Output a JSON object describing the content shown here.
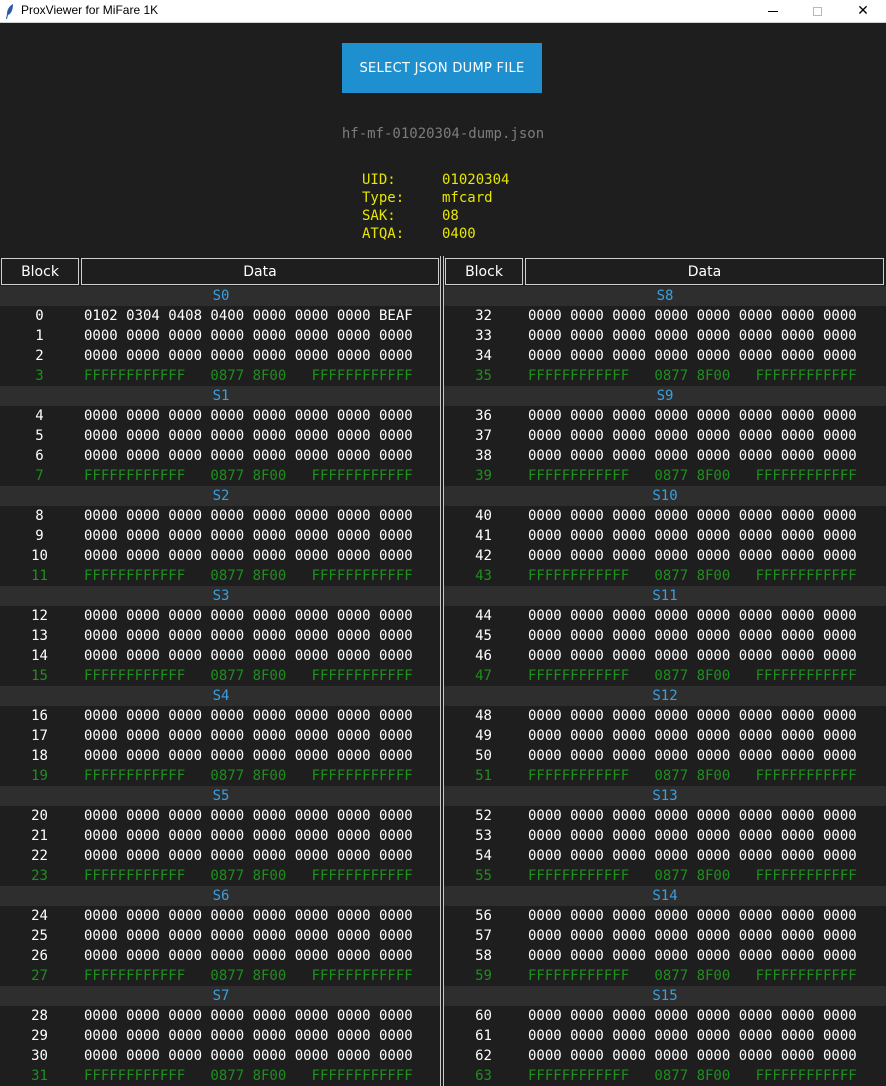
{
  "window": {
    "title": "ProxViewer for MiFare 1K",
    "minimize_glyph": "",
    "close_glyph": "✕"
  },
  "toolbar": {
    "select_button_label": "SELECT JSON DUMP FILE"
  },
  "file": {
    "name": "hf-mf-01020304-dump.json"
  },
  "card_info": [
    {
      "label": "UID:",
      "value": "01020304"
    },
    {
      "label": "Type:",
      "value": "mfcard"
    },
    {
      "label": "SAK:",
      "value": "08"
    },
    {
      "label": "ATQA:",
      "value": "0400"
    }
  ],
  "table_headers": {
    "block": "Block",
    "data": "Data"
  },
  "colors": {
    "accent": "#1e90cf",
    "sector_title": "#38a0e0",
    "info_text": "#e6e600",
    "trailer": "#1f8f1f",
    "background": "#1e1e1e"
  },
  "panels": [
    {
      "sectors": [
        {
          "title": "S0",
          "rows": [
            {
              "block": "0",
              "data": "0102 0304 0408 0400 0000 0000 0000 BEAF"
            },
            {
              "block": "1",
              "data": "0000 0000 0000 0000 0000 0000 0000 0000"
            },
            {
              "block": "2",
              "data": "0000 0000 0000 0000 0000 0000 0000 0000"
            },
            {
              "block": "3",
              "data": "FFFFFFFFFFFF   0877 8F00   FFFFFFFFFFFF",
              "trailer": true
            }
          ]
        },
        {
          "title": "S1",
          "rows": [
            {
              "block": "4",
              "data": "0000 0000 0000 0000 0000 0000 0000 0000"
            },
            {
              "block": "5",
              "data": "0000 0000 0000 0000 0000 0000 0000 0000"
            },
            {
              "block": "6",
              "data": "0000 0000 0000 0000 0000 0000 0000 0000"
            },
            {
              "block": "7",
              "data": "FFFFFFFFFFFF   0877 8F00   FFFFFFFFFFFF",
              "trailer": true
            }
          ]
        },
        {
          "title": "S2",
          "rows": [
            {
              "block": "8",
              "data": "0000 0000 0000 0000 0000 0000 0000 0000"
            },
            {
              "block": "9",
              "data": "0000 0000 0000 0000 0000 0000 0000 0000"
            },
            {
              "block": "10",
              "data": "0000 0000 0000 0000 0000 0000 0000 0000"
            },
            {
              "block": "11",
              "data": "FFFFFFFFFFFF   0877 8F00   FFFFFFFFFFFF",
              "trailer": true
            }
          ]
        },
        {
          "title": "S3",
          "rows": [
            {
              "block": "12",
              "data": "0000 0000 0000 0000 0000 0000 0000 0000"
            },
            {
              "block": "13",
              "data": "0000 0000 0000 0000 0000 0000 0000 0000"
            },
            {
              "block": "14",
              "data": "0000 0000 0000 0000 0000 0000 0000 0000"
            },
            {
              "block": "15",
              "data": "FFFFFFFFFFFF   0877 8F00   FFFFFFFFFFFF",
              "trailer": true
            }
          ]
        },
        {
          "title": "S4",
          "rows": [
            {
              "block": "16",
              "data": "0000 0000 0000 0000 0000 0000 0000 0000"
            },
            {
              "block": "17",
              "data": "0000 0000 0000 0000 0000 0000 0000 0000"
            },
            {
              "block": "18",
              "data": "0000 0000 0000 0000 0000 0000 0000 0000"
            },
            {
              "block": "19",
              "data": "FFFFFFFFFFFF   0877 8F00   FFFFFFFFFFFF",
              "trailer": true
            }
          ]
        },
        {
          "title": "S5",
          "rows": [
            {
              "block": "20",
              "data": "0000 0000 0000 0000 0000 0000 0000 0000"
            },
            {
              "block": "21",
              "data": "0000 0000 0000 0000 0000 0000 0000 0000"
            },
            {
              "block": "22",
              "data": "0000 0000 0000 0000 0000 0000 0000 0000"
            },
            {
              "block": "23",
              "data": "FFFFFFFFFFFF   0877 8F00   FFFFFFFFFFFF",
              "trailer": true
            }
          ]
        },
        {
          "title": "S6",
          "rows": [
            {
              "block": "24",
              "data": "0000 0000 0000 0000 0000 0000 0000 0000"
            },
            {
              "block": "25",
              "data": "0000 0000 0000 0000 0000 0000 0000 0000"
            },
            {
              "block": "26",
              "data": "0000 0000 0000 0000 0000 0000 0000 0000"
            },
            {
              "block": "27",
              "data": "FFFFFFFFFFFF   0877 8F00   FFFFFFFFFFFF",
              "trailer": true
            }
          ]
        },
        {
          "title": "S7",
          "rows": [
            {
              "block": "28",
              "data": "0000 0000 0000 0000 0000 0000 0000 0000"
            },
            {
              "block": "29",
              "data": "0000 0000 0000 0000 0000 0000 0000 0000"
            },
            {
              "block": "30",
              "data": "0000 0000 0000 0000 0000 0000 0000 0000"
            },
            {
              "block": "31",
              "data": "FFFFFFFFFFFF   0877 8F00   FFFFFFFFFFFF",
              "trailer": true
            }
          ]
        }
      ]
    },
    {
      "sectors": [
        {
          "title": "S8",
          "rows": [
            {
              "block": "32",
              "data": "0000 0000 0000 0000 0000 0000 0000 0000"
            },
            {
              "block": "33",
              "data": "0000 0000 0000 0000 0000 0000 0000 0000"
            },
            {
              "block": "34",
              "data": "0000 0000 0000 0000 0000 0000 0000 0000"
            },
            {
              "block": "35",
              "data": "FFFFFFFFFFFF   0877 8F00   FFFFFFFFFFFF",
              "trailer": true
            }
          ]
        },
        {
          "title": "S9",
          "rows": [
            {
              "block": "36",
              "data": "0000 0000 0000 0000 0000 0000 0000 0000"
            },
            {
              "block": "37",
              "data": "0000 0000 0000 0000 0000 0000 0000 0000"
            },
            {
              "block": "38",
              "data": "0000 0000 0000 0000 0000 0000 0000 0000"
            },
            {
              "block": "39",
              "data": "FFFFFFFFFFFF   0877 8F00   FFFFFFFFFFFF",
              "trailer": true
            }
          ]
        },
        {
          "title": "S10",
          "rows": [
            {
              "block": "40",
              "data": "0000 0000 0000 0000 0000 0000 0000 0000"
            },
            {
              "block": "41",
              "data": "0000 0000 0000 0000 0000 0000 0000 0000"
            },
            {
              "block": "42",
              "data": "0000 0000 0000 0000 0000 0000 0000 0000"
            },
            {
              "block": "43",
              "data": "FFFFFFFFFFFF   0877 8F00   FFFFFFFFFFFF",
              "trailer": true
            }
          ]
        },
        {
          "title": "S11",
          "rows": [
            {
              "block": "44",
              "data": "0000 0000 0000 0000 0000 0000 0000 0000"
            },
            {
              "block": "45",
              "data": "0000 0000 0000 0000 0000 0000 0000 0000"
            },
            {
              "block": "46",
              "data": "0000 0000 0000 0000 0000 0000 0000 0000"
            },
            {
              "block": "47",
              "data": "FFFFFFFFFFFF   0877 8F00   FFFFFFFFFFFF",
              "trailer": true
            }
          ]
        },
        {
          "title": "S12",
          "rows": [
            {
              "block": "48",
              "data": "0000 0000 0000 0000 0000 0000 0000 0000"
            },
            {
              "block": "49",
              "data": "0000 0000 0000 0000 0000 0000 0000 0000"
            },
            {
              "block": "50",
              "data": "0000 0000 0000 0000 0000 0000 0000 0000"
            },
            {
              "block": "51",
              "data": "FFFFFFFFFFFF   0877 8F00   FFFFFFFFFFFF",
              "trailer": true
            }
          ]
        },
        {
          "title": "S13",
          "rows": [
            {
              "block": "52",
              "data": "0000 0000 0000 0000 0000 0000 0000 0000"
            },
            {
              "block": "53",
              "data": "0000 0000 0000 0000 0000 0000 0000 0000"
            },
            {
              "block": "54",
              "data": "0000 0000 0000 0000 0000 0000 0000 0000"
            },
            {
              "block": "55",
              "data": "FFFFFFFFFFFF   0877 8F00   FFFFFFFFFFFF",
              "trailer": true
            }
          ]
        },
        {
          "title": "S14",
          "rows": [
            {
              "block": "56",
              "data": "0000 0000 0000 0000 0000 0000 0000 0000"
            },
            {
              "block": "57",
              "data": "0000 0000 0000 0000 0000 0000 0000 0000"
            },
            {
              "block": "58",
              "data": "0000 0000 0000 0000 0000 0000 0000 0000"
            },
            {
              "block": "59",
              "data": "FFFFFFFFFFFF   0877 8F00   FFFFFFFFFFFF",
              "trailer": true
            }
          ]
        },
        {
          "title": "S15",
          "rows": [
            {
              "block": "60",
              "data": "0000 0000 0000 0000 0000 0000 0000 0000"
            },
            {
              "block": "61",
              "data": "0000 0000 0000 0000 0000 0000 0000 0000"
            },
            {
              "block": "62",
              "data": "0000 0000 0000 0000 0000 0000 0000 0000"
            },
            {
              "block": "63",
              "data": "FFFFFFFFFFFF   0877 8F00   FFFFFFFFFFFF",
              "trailer": true
            }
          ]
        }
      ]
    }
  ]
}
